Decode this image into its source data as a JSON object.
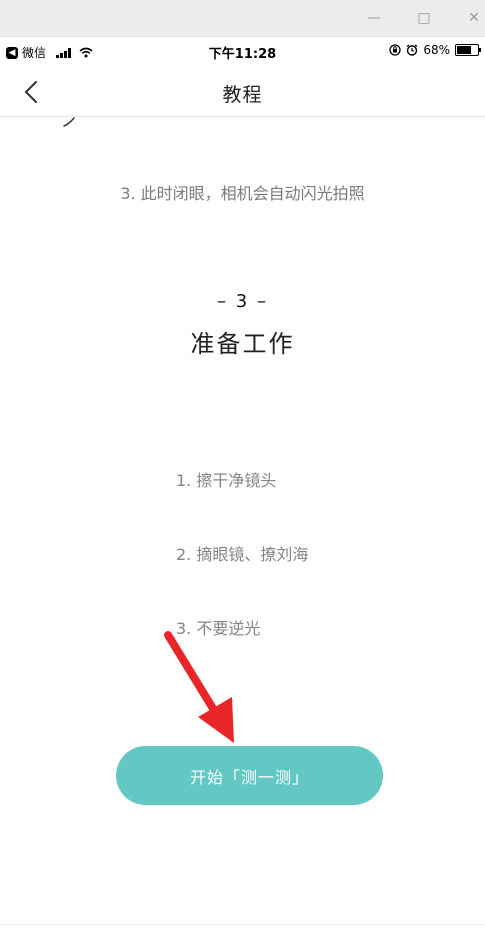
{
  "window_controls": {
    "minimize": "—",
    "maximize": "□",
    "close": "✕"
  },
  "status_bar": {
    "app_name": "微信",
    "time": "下午11:28",
    "battery": "68%",
    "battery_level": 0.68
  },
  "nav": {
    "title": "教程"
  },
  "steps": {
    "step3": "3. 此时闭眼，相机会自动闪光拍照"
  },
  "section": {
    "number": "– 3 –",
    "title": "准备工作",
    "items": [
      "1. 擦干净镜头",
      "2. 摘眼镜、撩刘海",
      "3. 不要逆光"
    ]
  },
  "start_button": {
    "label": "开始「测一测」"
  },
  "colors": {
    "accent": "#63c7c4",
    "arrow": "#e8262a"
  },
  "icons": {
    "back": "chevron-left-icon",
    "wifi": "wifi-icon",
    "alarm": "alarm-icon",
    "lock": "rotation-lock-icon"
  }
}
